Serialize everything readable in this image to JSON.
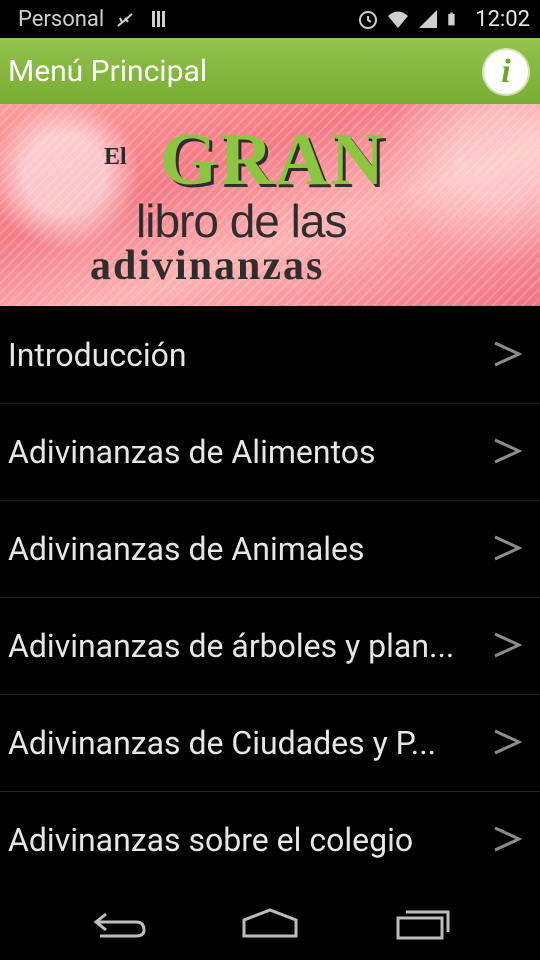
{
  "status_bar": {
    "carrier": "Personal",
    "time": "12:02",
    "icons": [
      "usb-icon",
      "sd-card-icon",
      "alarm-icon",
      "wifi-icon",
      "signal-icon",
      "battery-icon"
    ]
  },
  "action_bar": {
    "title": "Menú Principal",
    "info_icon": "info-icon",
    "info_glyph": "i",
    "color": "#84b843"
  },
  "banner": {
    "line_el": "El",
    "line_gran": "GRAN",
    "line_libro": "libro de las",
    "line_adivinanzas": "adivinanzas"
  },
  "menu": {
    "items": [
      {
        "label": "Introducción"
      },
      {
        "label": "Adivinanzas de Alimentos"
      },
      {
        "label": "Adivinanzas de Animales"
      },
      {
        "label": "Adivinanzas de árboles y plan..."
      },
      {
        "label": "Adivinanzas de Ciudades y P..."
      },
      {
        "label": "Adivinanzas sobre el colegio"
      }
    ],
    "chevron_icon": "chevron-right-icon"
  },
  "nav_bar": {
    "buttons": [
      "back-icon",
      "home-icon",
      "recents-icon"
    ]
  }
}
